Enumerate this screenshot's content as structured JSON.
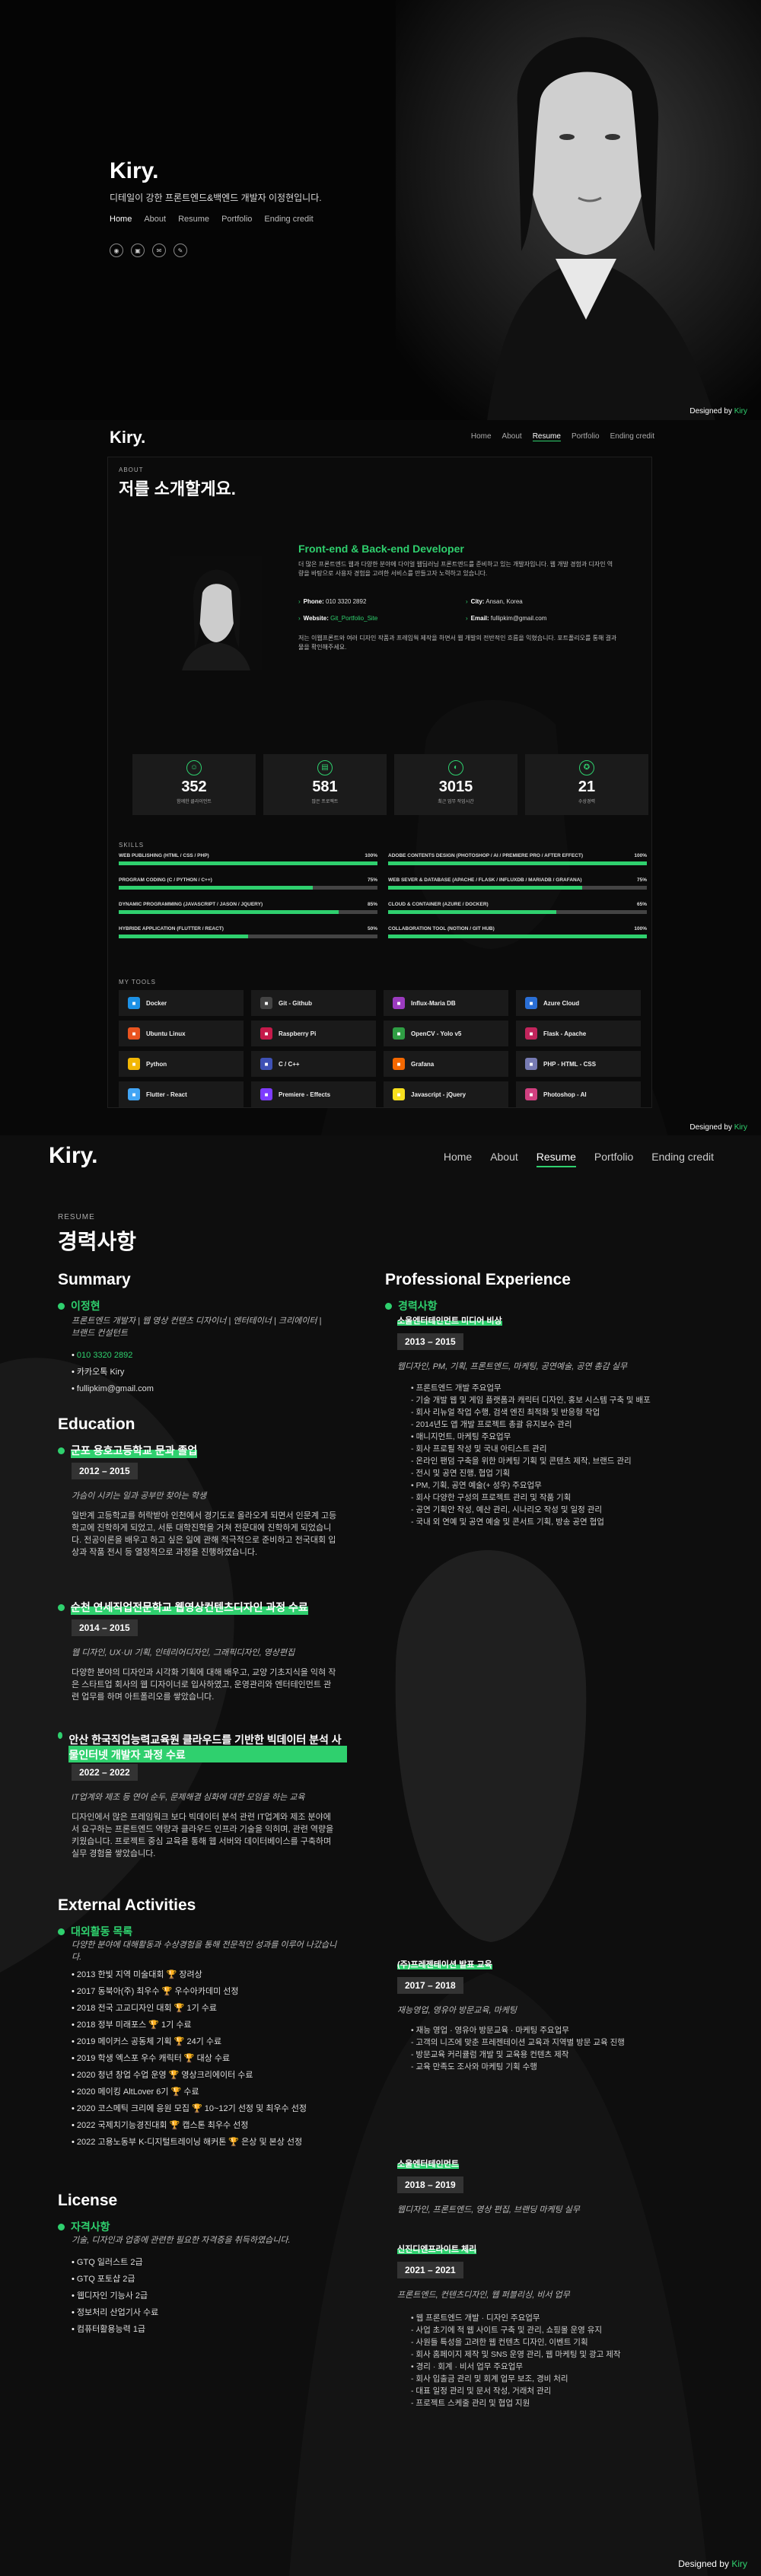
{
  "hero": {
    "logo": "Kiry.",
    "subtitle": "디테일이 강한 프론트엔드&백엔드 개발자 이정현입니다.",
    "nav": [
      "Home",
      "About",
      "Resume",
      "Portfolio",
      "Ending credit"
    ],
    "social_icons": [
      "github-icon",
      "instagram-icon",
      "mail-icon",
      "blog-icon"
    ],
    "credit_prefix": "Designed by",
    "credit_name": "Kiry"
  },
  "about": {
    "logo": "Kiry.",
    "nav": [
      "Home",
      "About",
      "Resume",
      "Portfolio",
      "Ending credit"
    ],
    "label": "ABOUT",
    "title": "저를 소개할게요.",
    "role": "Front-end & Back-end Developer",
    "desc": "더 많은 프론트엔드 웹과 다양한 분야에 다이얼 웹딥러닝 프론트엔드를 준비하고 있는 개발자입니다. 웹 개발 경험과 디자인 역량을 바탕으로 사용자 경험을 고려한 서비스를 만들고자 노력하고 있습니다.",
    "phone_label": "Phone:",
    "phone": "010 3320 2892",
    "city_label": "City:",
    "city": "Ansan, Korea",
    "website_label": "Website:",
    "website": "Git_Portfolio_Site",
    "email_label": "Email:",
    "email": "fullipkim@gmail.com",
    "desc2": "저는 이웹프론트와 여러 디자인 작품과 프레임웍 제작을 하면서 웹 개발의 전반적인 흐름을 익혔습니다. 포트폴리오를 통해 결과물을 확인해주세요.",
    "stats": [
      {
        "num": "352",
        "label": "함께한 클라이언트"
      },
      {
        "num": "581",
        "label": "많은 프로젝트"
      },
      {
        "num": "3015",
        "label": "최근 업무 작업시간"
      },
      {
        "num": "21",
        "label": "수상경력"
      }
    ],
    "skills_label": "SKILLS",
    "skills": [
      {
        "name": "WEB PUBLISHING (HTML / CSS / PHP)",
        "pct": "100%",
        "val": 1.0
      },
      {
        "name": "ADOBE CONTENTS DESIGN (PHOTOSHOP / AI / PREMIERE PRO / AFTER EFFECT)",
        "pct": "100%",
        "val": 1.0
      },
      {
        "name": "PROGRAM CODING (C / PYTHON / C++)",
        "pct": "75%",
        "val": 0.75
      },
      {
        "name": "WEB SEVER & DATABASE (APACHE / FLASK / INFLUXDB / MARIADB / GRAFANA)",
        "pct": "75%",
        "val": 0.75
      },
      {
        "name": "DYNAMIC PROGRAMMING (JAVASCRIPT / JASON / JQUERY)",
        "pct": "85%",
        "val": 0.85
      },
      {
        "name": "CLOUD & CONTAINER (AZURE / DOCKER)",
        "pct": "65%",
        "val": 0.65
      },
      {
        "name": "HYBRIDE APPLICATION (FLUTTER / REACT)",
        "pct": "50%",
        "val": 0.5
      },
      {
        "name": "COLLABORATION TOOL (NOTION / GIT HUB)",
        "pct": "100%",
        "val": 1.0
      }
    ],
    "tools_label": "MY TOOLS",
    "tools": [
      {
        "name": "Docker",
        "icon": "docker-icon",
        "color": "#1d91e6"
      },
      {
        "name": "Git - Github",
        "icon": "github-icon",
        "color": "#444444"
      },
      {
        "name": "Influx-Maria DB",
        "icon": "database-icon",
        "color": "#9b3bbf"
      },
      {
        "name": "Azure Cloud",
        "icon": "azure-icon",
        "color": "#2a6fd6"
      },
      {
        "name": "Ubuntu Linux",
        "icon": "ubuntu-icon",
        "color": "#e95420"
      },
      {
        "name": "Raspberry Pi",
        "icon": "raspberry-icon",
        "color": "#c51a4a"
      },
      {
        "name": "OpenCV - Yolo v5",
        "icon": "opencv-icon",
        "color": "#2f9e44"
      },
      {
        "name": "Flask - Apache",
        "icon": "flask-icon",
        "color": "#c2255c"
      },
      {
        "name": "Python",
        "icon": "python-icon",
        "color": "#f2b705"
      },
      {
        "name": "C / C++",
        "icon": "cpp-icon",
        "color": "#3f51b5"
      },
      {
        "name": "Grafana",
        "icon": "grafana-icon",
        "color": "#f46800"
      },
      {
        "name": "PHP - HTML - CSS",
        "icon": "php-icon",
        "color": "#777bb3"
      },
      {
        "name": "Flutter - React",
        "icon": "flutter-icon",
        "color": "#42a5f5"
      },
      {
        "name": "Premiere - Effects",
        "icon": "premiere-icon",
        "color": "#7d3cff"
      },
      {
        "name": "Javascript - jQuery",
        "icon": "javascript-icon",
        "color": "#f7df1e"
      },
      {
        "name": "Photoshop - AI",
        "icon": "photoshop-icon",
        "color": "#d04080"
      }
    ],
    "credit_prefix": "Designed by",
    "credit_name": "Kiry"
  },
  "resume": {
    "logo": "Kiry.",
    "nav": [
      "Home",
      "About",
      "Resume",
      "Portfolio",
      "Ending credit"
    ],
    "label": "RESUME",
    "title": "경력사항",
    "summary_heading": "Summary",
    "summary_name": "이정현",
    "summary_desc": "프론트엔드 개발자 | 웹 영상 컨텐츠 디자이너 | 엔터테이너 | 크리에이터 | 브랜드 컨설턴트",
    "summary_items": [
      "010 3320 2892",
      "카카오톡 Kiry",
      "fullipkim@gmail.com"
    ],
    "education_heading": "Education",
    "education": [
      {
        "school": "군포 용호고등학교 문과 졸업",
        "years": "2012 – 2015",
        "note": "가슴이 시키는 일과 공부만 찾아는 학생",
        "text": "일반계 고등학교를 허락받아 인천에서 경기도로 올라오게 되면서 인문계 고등학교에 진학하게 되었고, 서툰 대학진학을 거쳐 전문대에 진학하게 되었습니다. 전공이론을 배우고 하고 싶은 일에 관해 적극적으로 준비하고 전국대회 입상과 작품 전시 등 열정적으로 과정을 진행하였습니다."
      },
      {
        "school": "순천 연세직업전문학교 웹영상컨텐츠디자인 과정 수료",
        "years": "2014 – 2015",
        "note": "웹 디자인, UX·UI 기획, 인테리어디자인, 그래픽디자인, 영상편집",
        "text": "다양한 분야의 디자인과 시각화 기획에 대해 배우고, 교양 기초지식을 익혀 작은 스타트업 회사의 웹 디자이너로 입사하였고, 운영관리와 엔터테인먼트 관련 업무를 하며 아트폴리오를 쌓았습니다."
      },
      {
        "school": "안산 한국직업능력교육원 클라우드를 기반한 빅데이터 분석 사물인터넷 개발자 과정 수료",
        "years": "2022 – 2022",
        "note": "IT업계와 제조 등 연어 순두, 문제해결 심화에 대한 모임을 하는 교육",
        "text": "디자인에서 많은 프레임워크 보다 빅데이터 분석 관련 IT업계와 제조 분야에서 요구하는 프론트엔드 역량과 클라우드 인프라 기술을 익히며, 관련 역량을 키웠습니다. 프로젝트 중심 교육을 통해 웹 서버와 데이터베이스를 구축하며 실무 경험을 쌓았습니다."
      }
    ],
    "activities_heading": "External Activities",
    "activities_title": "대외활동 목록",
    "activities_note": "다양한 분야에 대해활동과 수상경험을 통해 전문적인 성과를 이루어 나갔습니다.",
    "activities": [
      "2013 한빛 지역 미술대회 🏆 장려상",
      "2017 동북아(주) 최우수 🏆 우수아카데미 선정",
      "2018 전국 고교디자인 대회 🏆 1기 수료",
      "2018 정부 미래포스 🏆 1기 수료",
      "2019 메이커스 공동체 기획 🏆 24기 수료",
      "2019 학생 엑스포 우수 캐릭터 🏆 대상 수료",
      "2020 청년 창업 수업 운영 🏆 영상크리에이터 수료",
      "2020 메이킹 AltLover 6기 🏆 수료",
      "2020 코스메틱 크리에 응원 모집 🏆 10~12기 선정 및 최우수 선정",
      "2022 국제치기능경진대회 🏆 캡스톤 최우수 선정",
      "2022 고용노동부 K-디지털트레이닝 해커톤 🏆 은상 및 본상 선정"
    ],
    "license_heading": "License",
    "license_title": "자격사항",
    "license_note": "기술, 디자인과 업종에 관련한 필요한 자격증을 취득하였습니다.",
    "licenses": [
      "GTQ 일러스트 2급",
      "GTQ 포토샵 2급",
      "웹디자인 기능사 2급",
      "정보처리 산업기사 수료",
      "컴퓨터활용능력 1급"
    ],
    "experience_heading": "Professional Experience",
    "experience_title": "경력사항",
    "experience": [
      {
        "company": "소울엔터테인먼트 미디어 비상",
        "years": "2013 – 2015",
        "note": "웹디자인, PM, 기획, 프론트엔드, 마케팅, 공연예술, 공연 총감 실무",
        "text": "• 프론트엔드 개발 주요업무\n- 기술 개발 웹 및 게임 플랫폼과 캐릭터 디자인, 홍보 시스템 구축 및 배포\n- 회사 리뉴얼 작업 수행, 검색 엔진 최적화 및 반응형 작업\n- 2014년도 앱 개발 프로젝트 총괄 유지보수 관리\n• 매니지먼트, 마케팅 주요업무\n- 회사 프로필 작성 및 국내 아티스트 관리\n- 온라인 팬덤 구축을 위한 마케팅 기획 및 콘텐츠 제작, 브랜드 관리\n- 전시 및 공연 진행, 협업 기획\n• PM, 기획, 공연 예술(+ 성우) 주요업무\n- 회사 다양한 구성의 프로젝트 관리 및 작품 기획\n- 공연 기획안 작성, 예산 관리, 시나리오 작성 및 일정 관리\n- 국내 외 연예 및 공연 예술 및 콘서트 기획, 방송 공연 협업"
      },
      {
        "company": "(주)프레젠테이션 발표 교육",
        "years": "2017 – 2018",
        "note": "재능영업, 영유아 방문교육, 마케팅",
        "text": "• 재능 영업 · 영유아 방문교육 · 마케팅 주요업무\n- 고객의 니즈에 맞춘 프레젠테이션 교육과 지역별 방문 교육 진행\n- 방문교육 커리큘럼 개발 및 교육용 컨텐츠 제작\n- 교육 만족도 조사와 마케팅 기획 수행"
      },
      {
        "company": "소울엔터테인먼트",
        "years": "2018 – 2019",
        "note": "웹디자인, 프론트엔드, 영상 편집, 브랜딩 마케팅 실무"
      },
      {
        "company": "신진디엔프라이트 체리",
        "years": "2021 – 2021",
        "note": "프론트엔드, 컨텐츠디자인, 웹 퍼블리싱, 비서 업무",
        "text": "• 웹 프론트엔드 개발 · 디자인 주요업무\n- 사업 초기에 적 웹 사이트 구축 및 관리, 쇼핑몰 운영 유지\n- 사원들 특성을 고려한 웹 컨텐츠 디자인, 이벤트 기획\n- 회사 홈페이지 제작 및 SNS 운영 관리, 웹 마케팅 및 광고 제작\n• 경리 · 회계 · 비서 업무 주요업무\n- 회사 입출금 관리 및 회계 업무 보조, 경비 처리\n- 대표 일정 관리 및 문서 작성, 거래처 관리\n- 프로젝트 스케줄 관리 및 협업 지원"
      }
    ],
    "credit_prefix": "Designed by",
    "credit_name": "Kiry"
  }
}
